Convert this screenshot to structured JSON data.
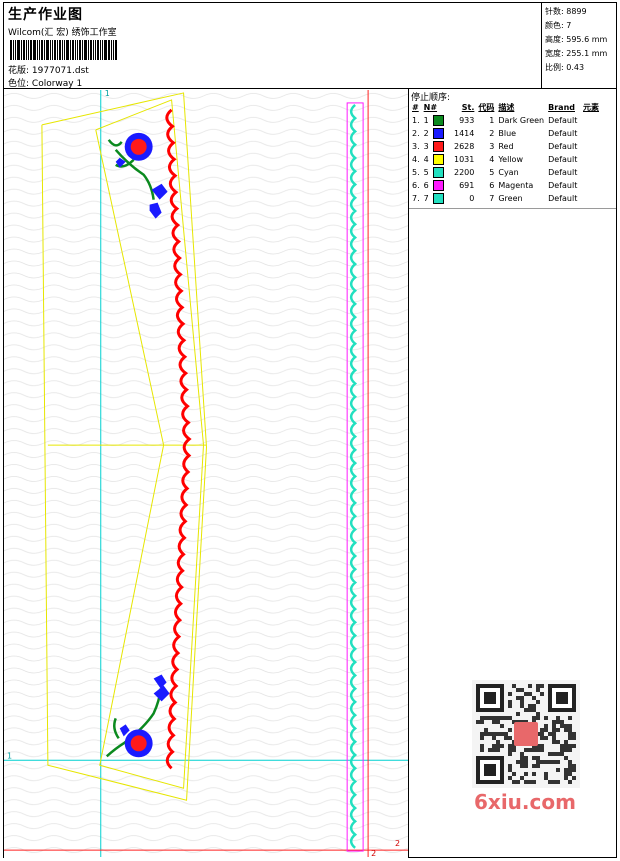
{
  "header": {
    "title": "生产作业图",
    "studio": "Wilcom(汇 宏) 绣饰工作室",
    "design_label": "花版:",
    "design_value": "1977071.dst",
    "colorway_label": "色位:",
    "colorway_value": "Colorway 1"
  },
  "stats": {
    "stitches_label": "针数:",
    "stitches_value": "8899",
    "colors_label": "颜色:",
    "colors_value": "7",
    "height_label": "高度:",
    "height_value": "595.6 mm",
    "width_label": "宽度:",
    "width_value": "255.1 mm",
    "scale_label": "比例:",
    "scale_value": "0.43"
  },
  "stop_sequence": {
    "title": "停止顺序:",
    "columns": [
      "#",
      "N#",
      "St.",
      "代码",
      "描述",
      "Brand",
      "元素"
    ],
    "rows": [
      {
        "idx": "1.",
        "n": "1",
        "color": "#0b8a1f",
        "st": "933",
        "code": "1",
        "desc": "Dark Green",
        "brand": "Default"
      },
      {
        "idx": "2.",
        "n": "2",
        "color": "#1a1aff",
        "st": "1414",
        "code": "2",
        "desc": "Blue",
        "brand": "Default"
      },
      {
        "idx": "3.",
        "n": "3",
        "color": "#ff1a1a",
        "st": "2628",
        "code": "3",
        "desc": "Red",
        "brand": "Default"
      },
      {
        "idx": "4.",
        "n": "4",
        "color": "#ffff00",
        "st": "1031",
        "code": "4",
        "desc": "Yellow",
        "brand": "Default"
      },
      {
        "idx": "5.",
        "n": "5",
        "color": "#22e0c0",
        "st": "2200",
        "code": "5",
        "desc": "Cyan",
        "brand": "Default"
      },
      {
        "idx": "6.",
        "n": "6",
        "color": "#ff1aff",
        "st": "691",
        "code": "6",
        "desc": "Magenta",
        "brand": "Default"
      },
      {
        "idx": "7.",
        "n": "7",
        "color": "#22e0c0",
        "st": "0",
        "code": "7",
        "desc": "Green",
        "brand": "Default"
      }
    ]
  },
  "canvas": {
    "guide_label_top": "1",
    "guide_label_left": "1",
    "guide_label_bottom_right": "2",
    "guide_label_bottom": "2"
  },
  "watermark": "6xiu.com"
}
